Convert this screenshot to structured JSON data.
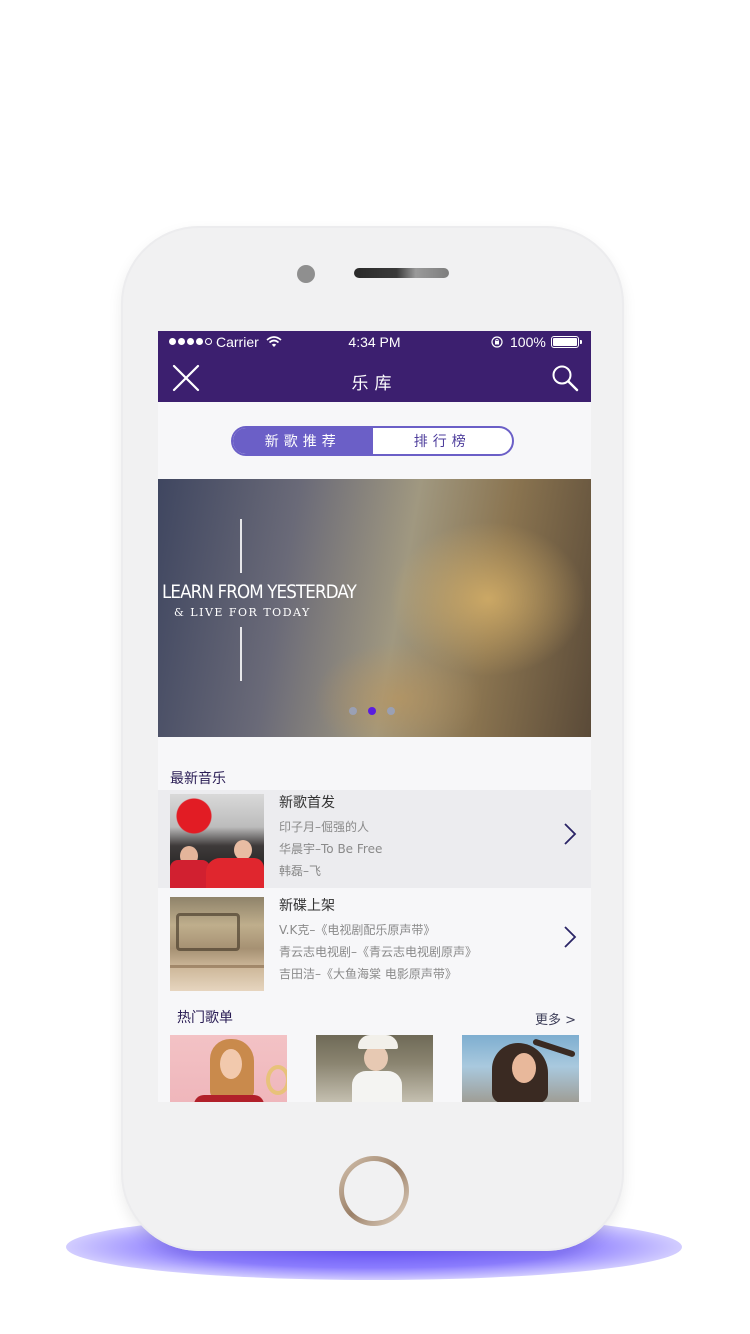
{
  "status_bar": {
    "carrier": "Carrier",
    "time": "4:34 PM",
    "battery": "100%"
  },
  "nav": {
    "title": "乐库",
    "close_icon": "close-icon",
    "search_icon": "search-icon"
  },
  "segment": {
    "tabs": [
      {
        "label": "新歌推荐",
        "active": true
      },
      {
        "label": "排行榜",
        "active": false
      }
    ],
    "active_color": "#6b5fc7"
  },
  "banner": {
    "headline": "LEARN FROM YESTERDAY",
    "subline": "& LIVE FOR TODAY",
    "pages": 3,
    "current_page": 2
  },
  "latest_music": {
    "title": "最新音乐",
    "items": [
      {
        "title": "新歌首发",
        "lines": [
          "印子月–倔强的人",
          "华晨宇–To Be Free",
          "韩磊–飞"
        ]
      },
      {
        "title": "新碟上架",
        "lines": [
          "V.K克–《电视剧配乐原声带》",
          "青云志电视剧–《青云志电视剧原声》",
          "吉田洁–《大鱼海棠 电影原声带》"
        ]
      }
    ]
  },
  "hot_playlists": {
    "title": "热门歌单",
    "more": "更多 >"
  },
  "colors": {
    "header": "#3c1f6f",
    "accent": "#6b5fc7",
    "pager_active": "#5a1de0"
  }
}
